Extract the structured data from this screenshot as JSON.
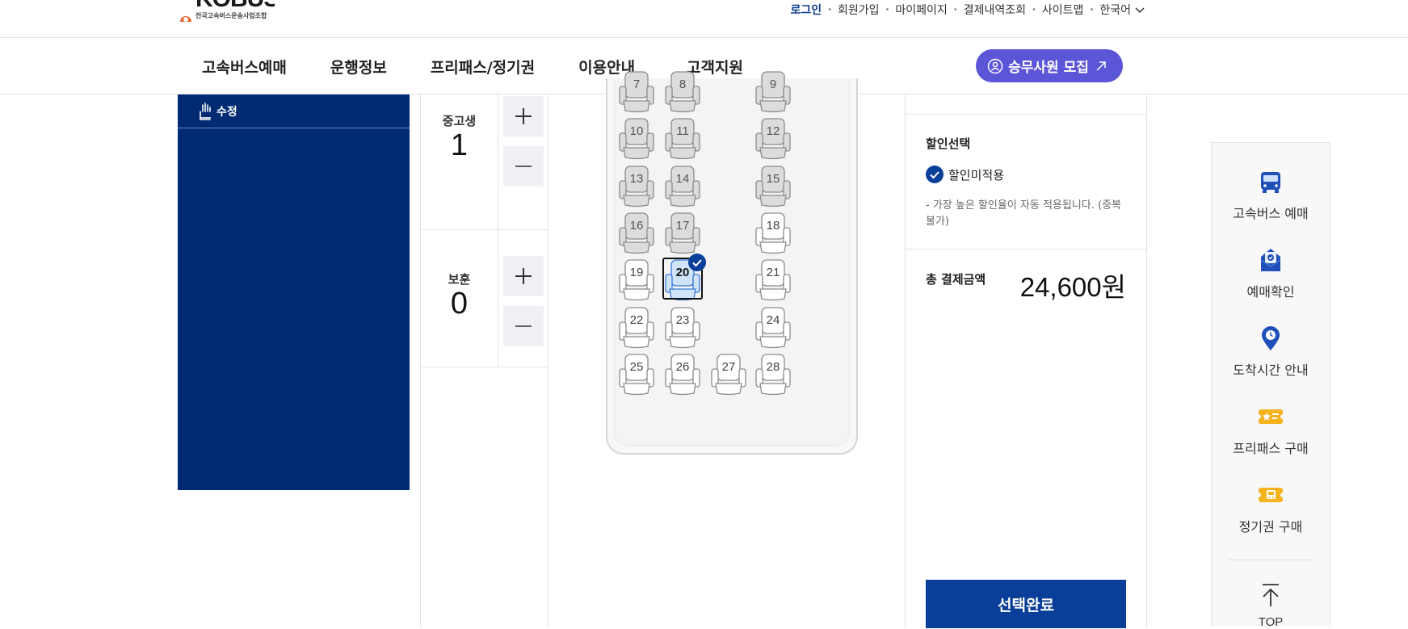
{
  "header": {
    "logo_text": "KOBUS",
    "logo_sub": "전국고속버스운송사업조합",
    "util_links": [
      "로그인",
      "회원가입",
      "마이페이지",
      "결제내역조회",
      "사이트맵",
      "한국어"
    ]
  },
  "nav": {
    "items": [
      "고속버스예매",
      "운행정보",
      "프리패스/정기권",
      "이용안내",
      "고객지원"
    ],
    "recruit_label": "승무사원 모집"
  },
  "left_panel": {
    "edit_label": "수정"
  },
  "passengers": [
    {
      "label": "중고생",
      "count": "1"
    },
    {
      "label": "보훈",
      "count": "0"
    }
  ],
  "seat_map": {
    "seats": [
      {
        "num": "7",
        "state": "disabled"
      },
      {
        "num": "8",
        "state": "disabled"
      },
      {
        "num": "9",
        "state": "disabled"
      },
      {
        "num": "10",
        "state": "disabled"
      },
      {
        "num": "11",
        "state": "disabled"
      },
      {
        "num": "12",
        "state": "disabled"
      },
      {
        "num": "13",
        "state": "disabled"
      },
      {
        "num": "14",
        "state": "disabled"
      },
      {
        "num": "15",
        "state": "disabled"
      },
      {
        "num": "16",
        "state": "disabled"
      },
      {
        "num": "17",
        "state": "disabled"
      },
      {
        "num": "18",
        "state": "available"
      },
      {
        "num": "19",
        "state": "available"
      },
      {
        "num": "20",
        "state": "selected"
      },
      {
        "num": "21",
        "state": "available"
      },
      {
        "num": "22",
        "state": "available"
      },
      {
        "num": "23",
        "state": "available"
      },
      {
        "num": "24",
        "state": "available"
      },
      {
        "num": "25",
        "state": "available"
      },
      {
        "num": "26",
        "state": "available"
      },
      {
        "num": "27",
        "state": "available"
      },
      {
        "num": "28",
        "state": "available"
      }
    ]
  },
  "summary": {
    "discount_title": "할인선택",
    "discount_option": "할인미적용",
    "discount_note": "- 가장 높은 할인율이 자동 적용됩니다. (중복불가)",
    "total_label": "총 결제금액",
    "total_value": "24,600원",
    "confirm_label": "선택완료"
  },
  "quick_menu": {
    "items": [
      {
        "label": "고속버스 예매",
        "icon": "bus-icon"
      },
      {
        "label": "예매확인",
        "icon": "ticket-check-icon"
      },
      {
        "label": "도착시간 안내",
        "icon": "location-pin-icon"
      },
      {
        "label": "프리패스 구매",
        "icon": "freepass-icon"
      },
      {
        "label": "정기권 구매",
        "icon": "season-ticket-icon"
      }
    ],
    "top_label": "TOP"
  },
  "colors": {
    "navy": "#002a72",
    "primary_button": "#0a3f99",
    "recruit": "#5d55d8",
    "selected_seat": "#cfe3fb"
  }
}
